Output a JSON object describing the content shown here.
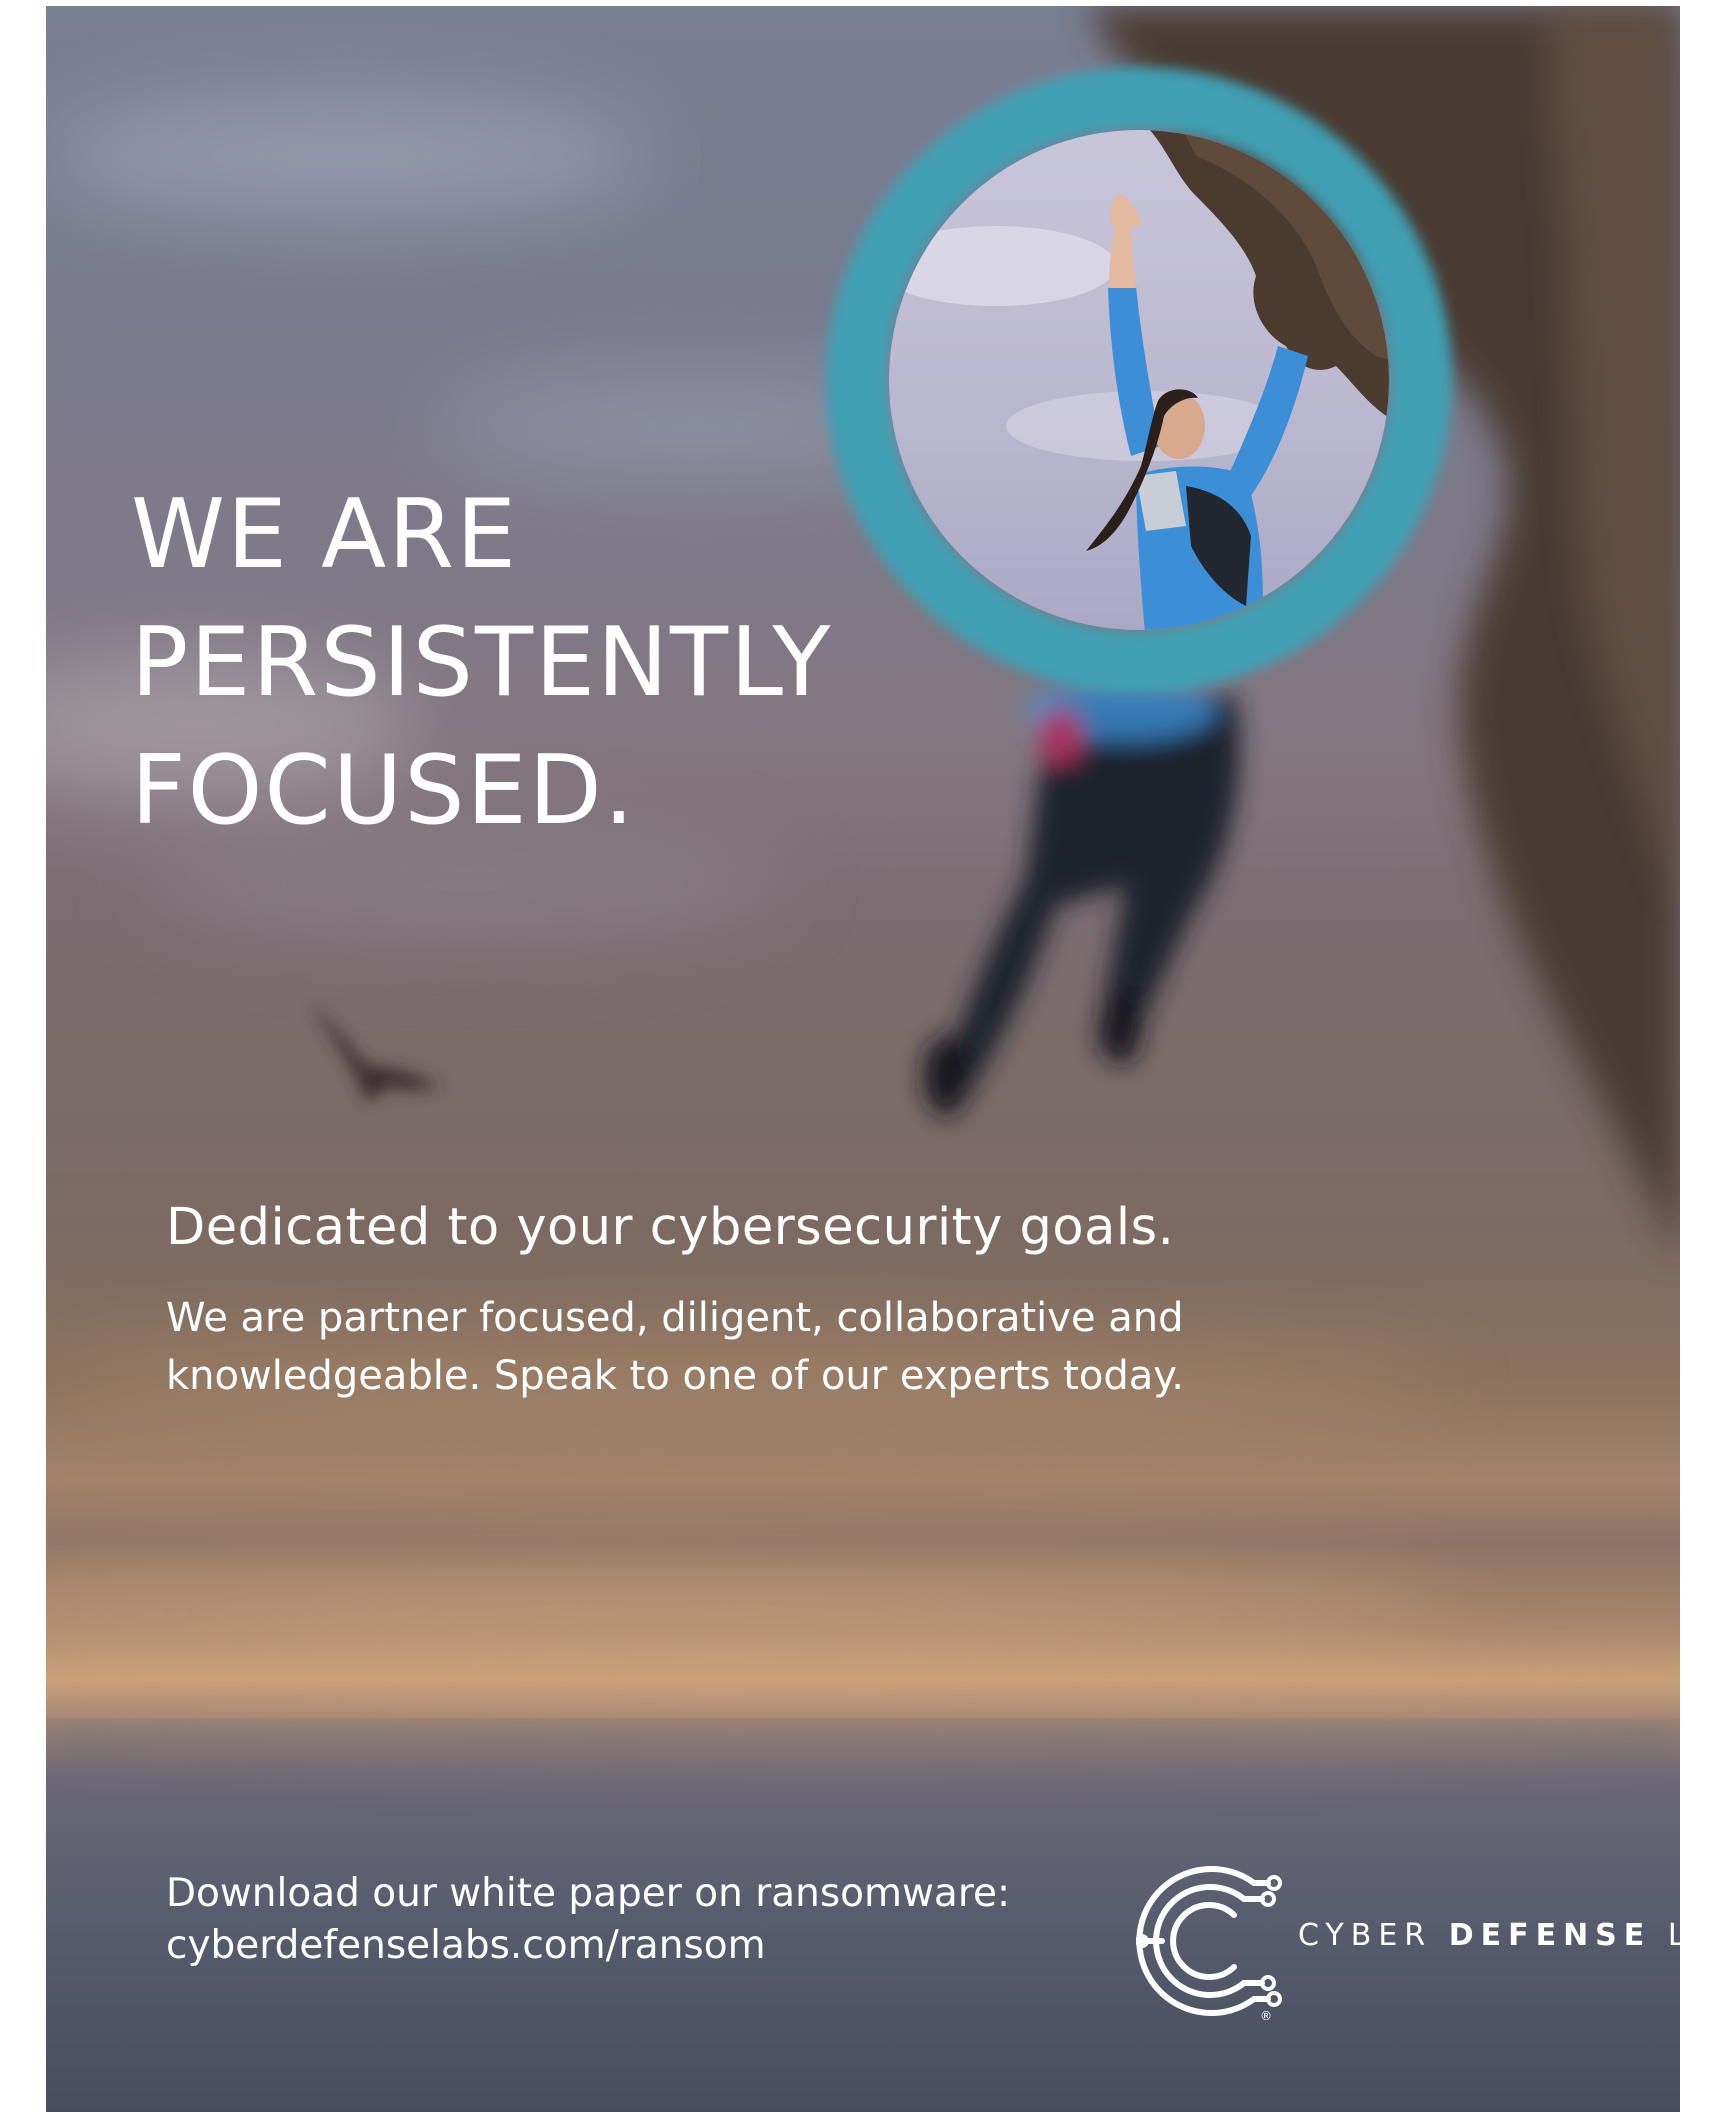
{
  "headline": [
    "WE ARE",
    "PERSISTENTLY",
    "FOCUSED."
  ],
  "subhead": "Dedicated to your cybersecurity goals.",
  "body": [
    "We are partner focused, diligent, collaborative and",
    "knowledgeable. Speak to one of our experts today."
  ],
  "cta": [
    "Download our white paper on ransomware:",
    "cyberdefenselabs.com/ransom"
  ],
  "logo": {
    "word1": "CYBER",
    "word2": "DEFENSE",
    "word3": "LABS",
    "registered": "®"
  },
  "colors": {
    "accent_teal": "#3f9fb3",
    "text": "#ffffff",
    "climber_shirt": "#3c8fd6"
  },
  "icons": [
    "circuit-c-logo-icon",
    "bird-icon"
  ]
}
